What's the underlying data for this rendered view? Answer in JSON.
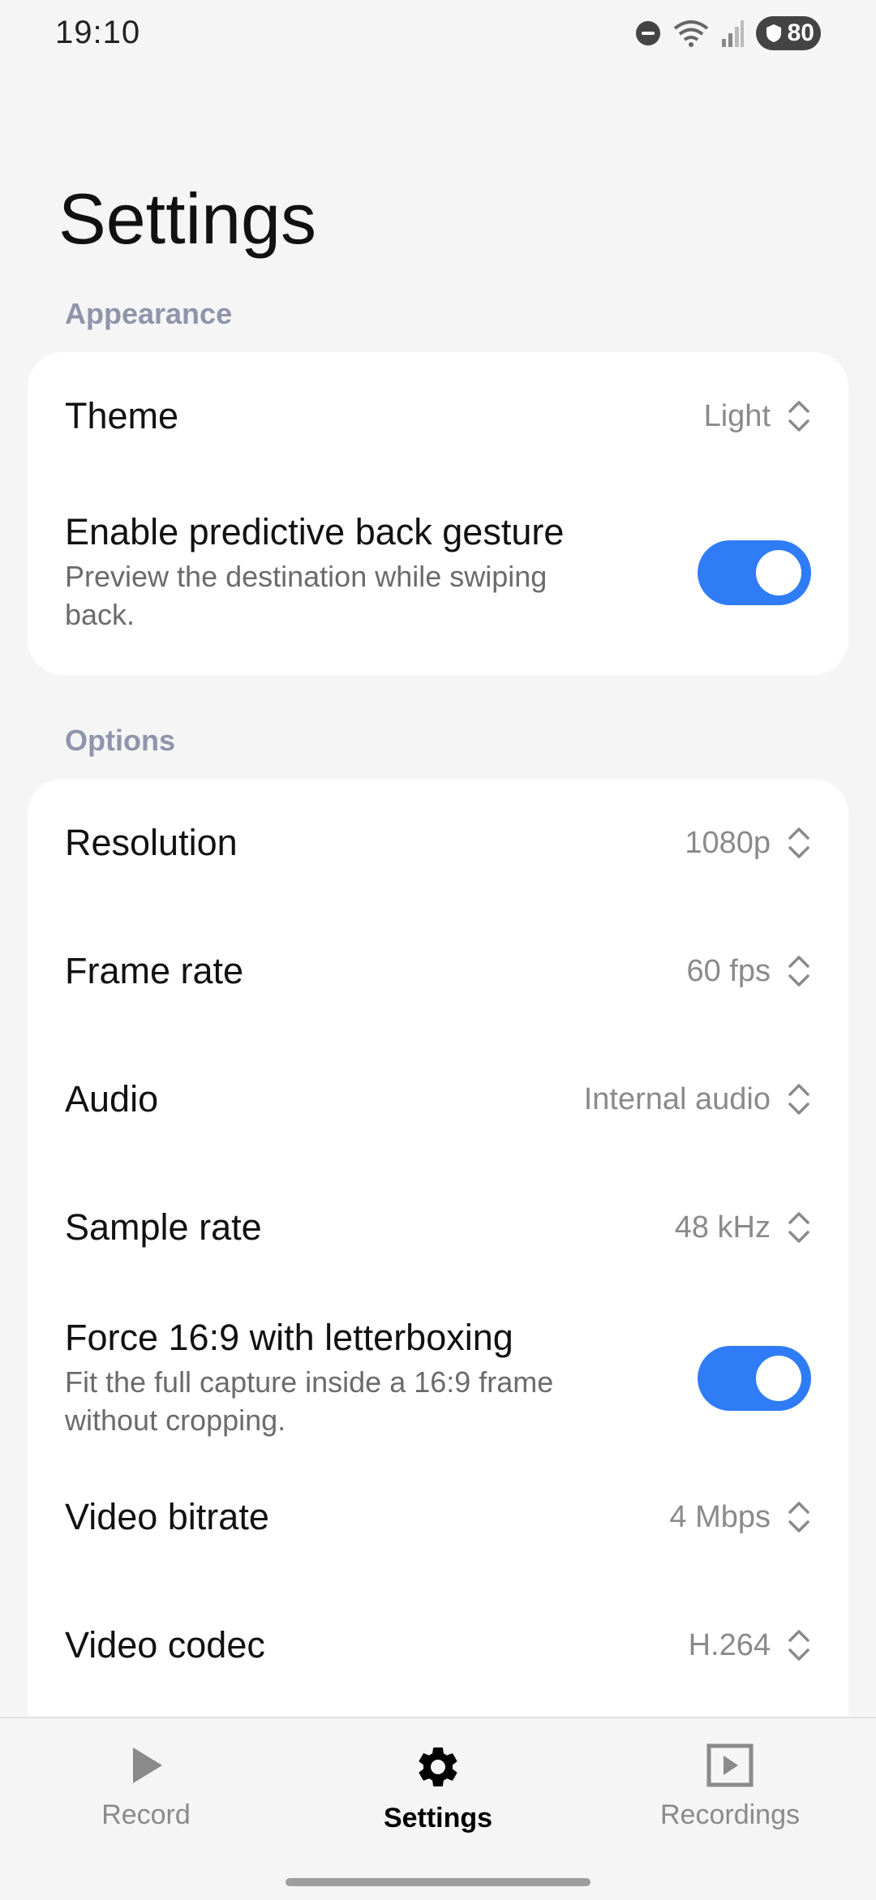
{
  "status_bar": {
    "time": "19:10",
    "battery_level": "80",
    "icons": [
      "dnd-icon",
      "wifi-icon",
      "signal-icon",
      "battery-icon"
    ]
  },
  "page": {
    "title": "Settings"
  },
  "sections": {
    "appearance": {
      "label": "Appearance",
      "theme": {
        "label": "Theme",
        "value": "Light"
      },
      "predictive_back": {
        "label": "Enable predictive back gesture",
        "description": "Preview the destination while swiping back.",
        "enabled": true
      }
    },
    "options": {
      "label": "Options",
      "resolution": {
        "label": "Resolution",
        "value": "1080p"
      },
      "frame_rate": {
        "label": "Frame rate",
        "value": "60 fps"
      },
      "audio": {
        "label": "Audio",
        "value": "Internal audio"
      },
      "sample_rate": {
        "label": "Sample rate",
        "value": "48 kHz"
      },
      "letterboxing": {
        "label": "Force 16:9 with letterboxing",
        "description": "Fit the full capture inside a 16:9 frame without cropping.",
        "enabled": true
      },
      "video_bitrate": {
        "label": "Video bitrate",
        "value": "4 Mbps"
      },
      "video_codec": {
        "label": "Video codec",
        "value": "H.264"
      }
    }
  },
  "bottom_nav": {
    "record": "Record",
    "settings": "Settings",
    "recordings": "Recordings",
    "active": "Settings"
  },
  "colors": {
    "accent": "#2f7cf6",
    "section_label": "#8e95ab",
    "background": "#f5f5f5",
    "card": "#ffffff"
  }
}
